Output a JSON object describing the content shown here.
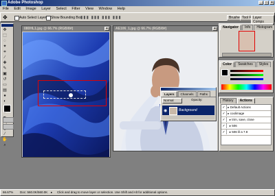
{
  "app": {
    "title": "Adobe Photoshop"
  },
  "menu": [
    "File",
    "Edit",
    "Image",
    "Layer",
    "Select",
    "Filter",
    "View",
    "Window",
    "Help"
  ],
  "options_bar": {
    "auto_select": "Auto Select Layer",
    "show_bounding": "Show Bounding Box",
    "palette_tabs": [
      "Brushes",
      "Tool Pr",
      "Layer Comps"
    ]
  },
  "doc1": {
    "title": "080HL1.jpg @ 66.7% (RGB/8#)"
  },
  "doc2": {
    "title": "AE106_1.jpg @ 66.7% (RGB/8#)"
  },
  "navigator": {
    "tabs": [
      "Navigator",
      "Info",
      "Histogram"
    ]
  },
  "color": {
    "tabs": [
      "Color",
      "Swatches",
      "Styles"
    ]
  },
  "history": {
    "tabs": [
      "History",
      "Actions"
    ],
    "items": [
      "Default Actions",
      "coolimage",
      "trim, save, close",
      "506",
      "506 lil a 7.8"
    ]
  },
  "layers": {
    "tabs": [
      "Layers",
      "Channels",
      "Paths"
    ],
    "mode": "Normal",
    "opacity_label": "Opacity:",
    "layer_name": "Background"
  },
  "status": {
    "zoom": "66.67%",
    "doc": "Doc: 560.0K/560.0K",
    "hint": "Click and drag to move layer or selection.  Use Shift and Alt for additional options."
  },
  "colors": {
    "accent": "#0a246a",
    "selection": "#e00000",
    "chrome": "#d4d0c8"
  },
  "icons": [
    "move-icon",
    "marquee-icon",
    "lasso-icon",
    "magic-wand-icon",
    "crop-icon",
    "slice-icon",
    "heal-icon",
    "brush-icon",
    "stamp-icon",
    "history-brush-icon",
    "eraser-icon",
    "gradient-icon",
    "blur-icon",
    "dodge-icon",
    "path-select-icon",
    "type-icon",
    "pen-icon",
    "shape-icon",
    "notes-icon",
    "eyedropper-icon",
    "hand-icon",
    "zoom-icon"
  ]
}
